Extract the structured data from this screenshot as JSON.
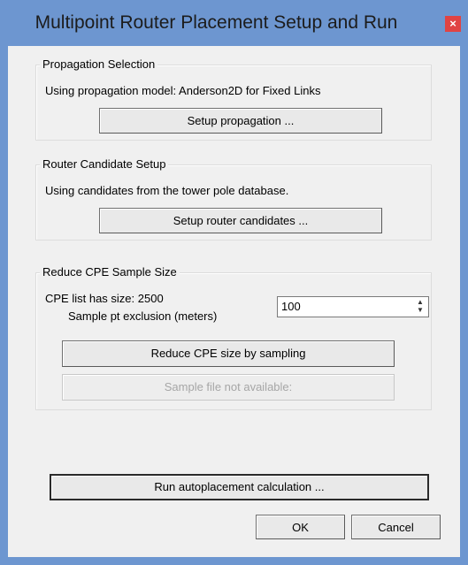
{
  "window": {
    "title": "Multipoint Router Placement Setup and Run",
    "close": "×"
  },
  "propagation": {
    "group_label": "Propagation Selection",
    "status": "Using propagation model:  Anderson2D for Fixed Links",
    "button": "Setup propagation ..."
  },
  "router": {
    "group_label": "Router Candidate Setup",
    "status": "Using candidates from the tower pole database.",
    "button": "Setup router candidates ..."
  },
  "cpe": {
    "group_label": "Reduce CPE Sample Size",
    "list_size": "CPE list has size: 2500",
    "exclusion_label": "Sample pt exclusion (meters)",
    "exclusion_value": "100",
    "reduce_button": "Reduce CPE size by sampling",
    "sample_button": "Sample file not available:"
  },
  "actions": {
    "run_button": "Run autoplacement calculation ...",
    "ok": "OK",
    "cancel": "Cancel"
  }
}
